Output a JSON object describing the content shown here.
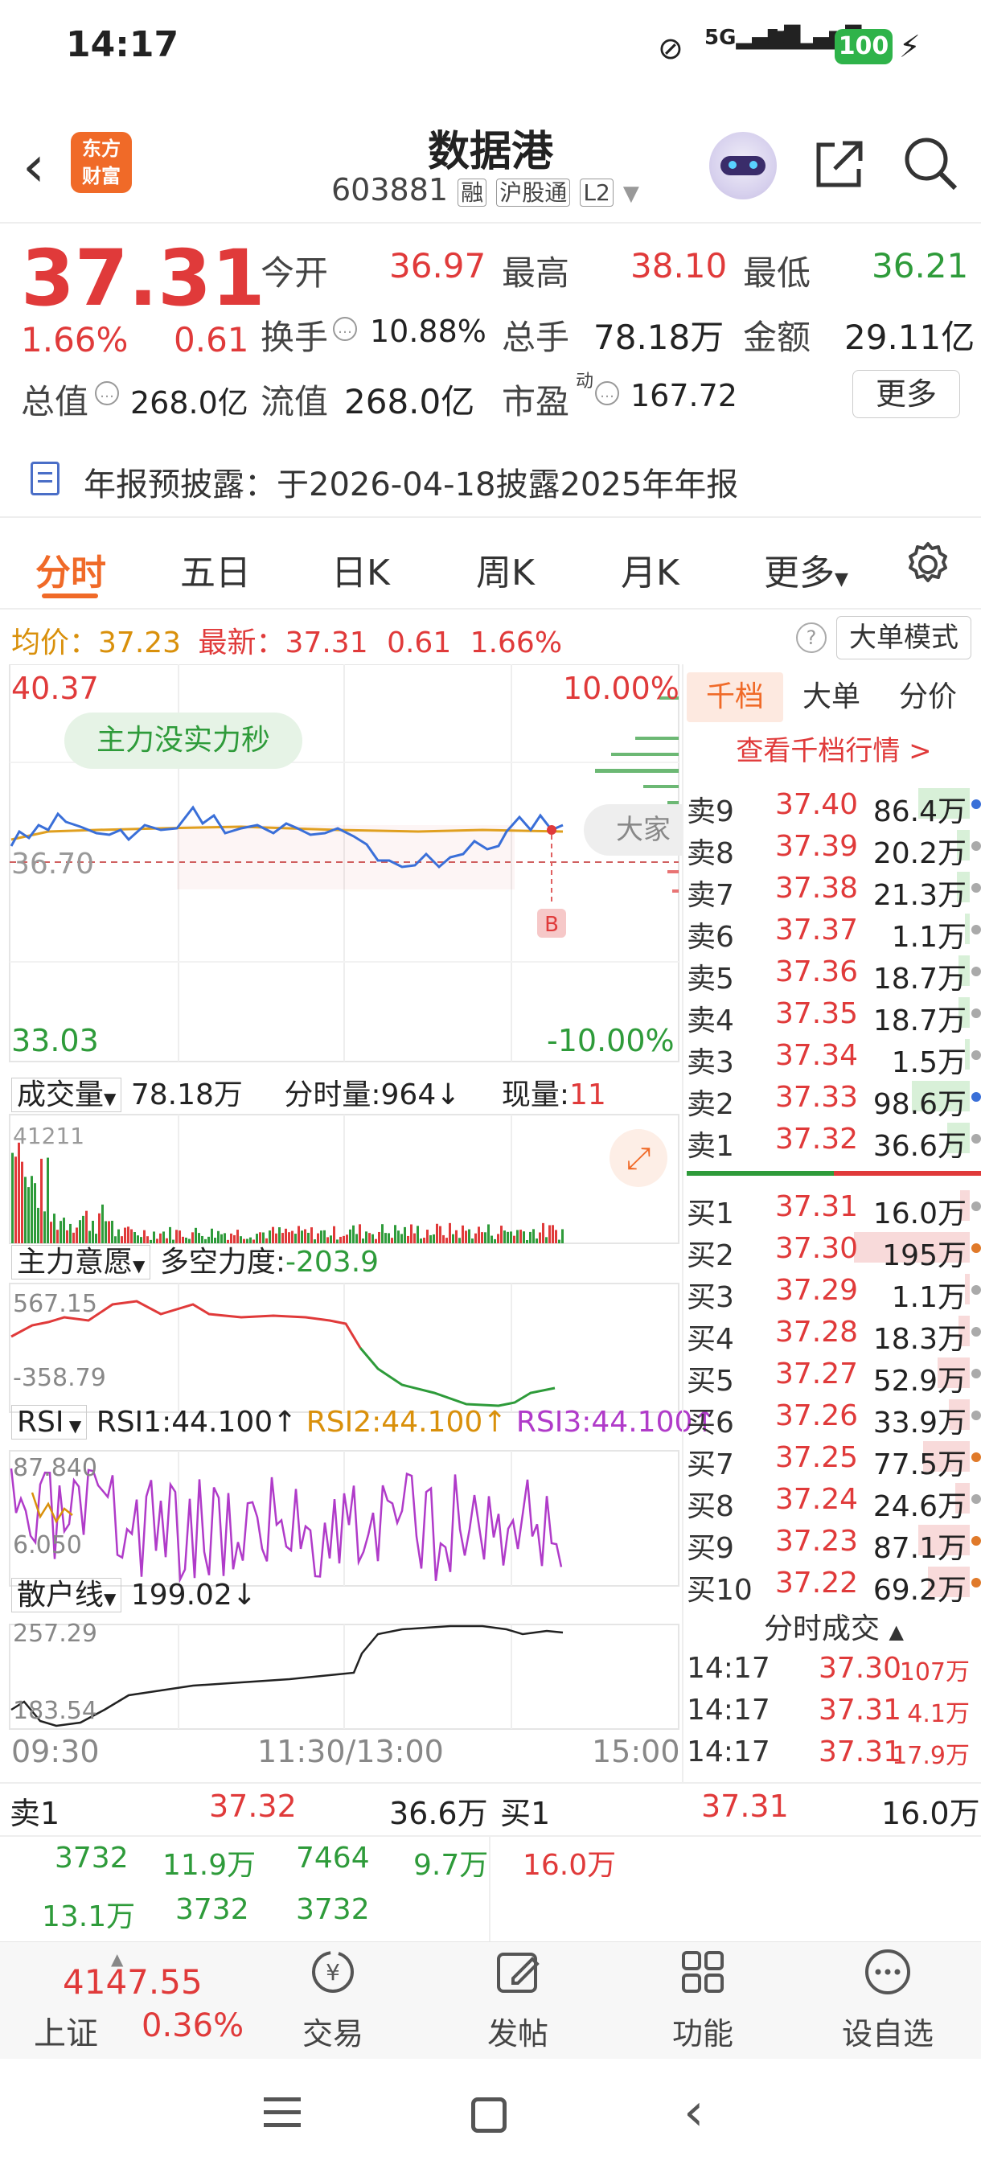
{
  "status": {
    "time": "14:17",
    "battery": "100",
    "net1": "5G",
    "net2": "5G"
  },
  "header": {
    "back_icon": "back-arrow-icon",
    "logo_line1": "东方",
    "logo_line2": "财富",
    "title": "数据港",
    "code": "603881",
    "tag1": "融",
    "tag2": "沪股通",
    "tag3": "L2"
  },
  "quote": {
    "price": "37.31",
    "pct": "1.66%",
    "change": "0.61",
    "open_label": "今开",
    "open": "36.97",
    "high_label": "最高",
    "high": "38.10",
    "low_label": "最低",
    "low": "36.21",
    "turnover_label": "换手",
    "turnover": "10.88%",
    "vol_label": "总手",
    "vol": "78.18万",
    "amount_label": "金额",
    "amount": "29.11亿",
    "mcap_label": "总值",
    "mcap": "268.0亿",
    "float_label": "流值",
    "float": "268.0亿",
    "pe_label": "市盈",
    "pe_sup": "动",
    "pe": "167.72",
    "more": "更多"
  },
  "notice": "年报预披露：于2026-04-18披露2025年年报",
  "tabs": [
    "分时",
    "五日",
    "日K",
    "周K",
    "月K",
    "更多"
  ],
  "info": {
    "avg_label": "均价：",
    "avg": "37.23",
    "latest_label": "最新：",
    "latest": "37.31",
    "chg": "0.61",
    "pct": "1.66%",
    "mode": "大单模式"
  },
  "chart": {
    "top": "40.37",
    "top_pct": "10.00%",
    "mid": "36.70",
    "bottom": "33.03",
    "bottom_pct": "-10.00%",
    "bubble": "主力没实力秒",
    "b_mark": "B",
    "side_label": "大家",
    "time_start": "09:30",
    "time_mid": "11:30/13:00",
    "time_end": "15:00"
  },
  "vol_panel": {
    "label": "成交量",
    "total": "78.18万",
    "fs_label": "分时量:",
    "fs": "964",
    "now_label": "现量:",
    "now": "11",
    "max": "41211"
  },
  "main_panel": {
    "label": "主力意愿",
    "dk_label": "多空力度:",
    "dk": "-203.9",
    "max": "567.15",
    "min": "-358.79"
  },
  "rsi_panel": {
    "label": "RSI",
    "rsi1": "RSI1:44.100",
    "rsi2": "RSI2:44.100",
    "rsi3": "RSI3:44.100",
    "max": "87.840",
    "min": "6.050"
  },
  "sh_panel": {
    "label": "散户线",
    "val": "199.02",
    "max": "257.29",
    "min": "183.54"
  },
  "ob_tabs": [
    "千档",
    "大单",
    "分价"
  ],
  "ob_link": "查看千档行情 >",
  "asks": [
    {
      "l": "卖9",
      "p": "37.40",
      "v": "86.4万",
      "bar": 0.32,
      "dot": "#3a6fd8"
    },
    {
      "l": "卖8",
      "p": "37.39",
      "v": "20.2万",
      "bar": 0.08,
      "dot": "#aaa"
    },
    {
      "l": "卖7",
      "p": "37.38",
      "v": "21.3万",
      "bar": 0.08,
      "dot": "#aaa"
    },
    {
      "l": "卖6",
      "p": "37.37",
      "v": "1.1万",
      "bar": 0.02,
      "dot": "#aaa"
    },
    {
      "l": "卖5",
      "p": "37.36",
      "v": "18.7万",
      "bar": 0.07,
      "dot": "#aaa"
    },
    {
      "l": "卖4",
      "p": "37.35",
      "v": "18.7万",
      "bar": 0.07,
      "dot": "#aaa"
    },
    {
      "l": "卖3",
      "p": "37.34",
      "v": "1.5万",
      "bar": 0.02,
      "dot": "#aaa"
    },
    {
      "l": "卖2",
      "p": "37.33",
      "v": "98.6万",
      "bar": 0.36,
      "dot": "#3a6fd8"
    },
    {
      "l": "卖1",
      "p": "37.32",
      "v": "36.6万",
      "bar": 0.14,
      "dot": "#aaa"
    }
  ],
  "bids": [
    {
      "l": "买1",
      "p": "37.31",
      "v": "16.0万",
      "bar": 0.06,
      "dot": "#aaa"
    },
    {
      "l": "买2",
      "p": "37.30",
      "v": "195万",
      "bar": 0.72,
      "dot": "#e07a2a"
    },
    {
      "l": "买3",
      "p": "37.29",
      "v": "1.1万",
      "bar": 0.02,
      "dot": "#aaa"
    },
    {
      "l": "买4",
      "p": "37.28",
      "v": "18.3万",
      "bar": 0.07,
      "dot": "#aaa"
    },
    {
      "l": "买5",
      "p": "37.27",
      "v": "52.9万",
      "bar": 0.2,
      "dot": "#aaa"
    },
    {
      "l": "买6",
      "p": "37.26",
      "v": "33.9万",
      "bar": 0.13,
      "dot": "#aaa"
    },
    {
      "l": "买7",
      "p": "37.25",
      "v": "77.5万",
      "bar": 0.29,
      "dot": "#e07a2a"
    },
    {
      "l": "买8",
      "p": "37.24",
      "v": "24.6万",
      "bar": 0.09,
      "dot": "#aaa"
    },
    {
      "l": "买9",
      "p": "37.23",
      "v": "87.1万",
      "bar": 0.32,
      "dot": "#e07a2a"
    },
    {
      "l": "买10",
      "p": "37.22",
      "v": "69.2万",
      "bar": 0.26,
      "dot": "#e07a2a"
    }
  ],
  "trades_title": "分时成交",
  "trades": [
    {
      "t": "14:17",
      "p": "37.30",
      "v": "107万"
    },
    {
      "t": "14:17",
      "p": "37.31",
      "v": "4.1万"
    },
    {
      "t": "14:17",
      "p": "37.31",
      "v": "17.9万"
    }
  ],
  "bottom_ob": {
    "sell_label": "卖1",
    "sell_price": "37.32",
    "sell_vol": "36.6万",
    "buy_label": "买1",
    "buy_price": "37.31",
    "buy_vol": "16.0万",
    "sell_items": [
      "3732",
      "11.9万",
      "7464",
      "9.7万",
      "13.1万",
      "3732",
      "3732"
    ],
    "buy_items": [
      "16.0万"
    ]
  },
  "bottom_nav": {
    "index_val": "4147.55",
    "index_name": "上证",
    "index_pct": "0.36%",
    "items": [
      "交易",
      "发帖",
      "功能",
      "设自选"
    ]
  },
  "colors": {
    "red": "#e03a3a",
    "green": "#2e9b3a",
    "accent": "#f06a28",
    "price_line": "#3a6fd8",
    "avg_line": "#e0a020"
  }
}
